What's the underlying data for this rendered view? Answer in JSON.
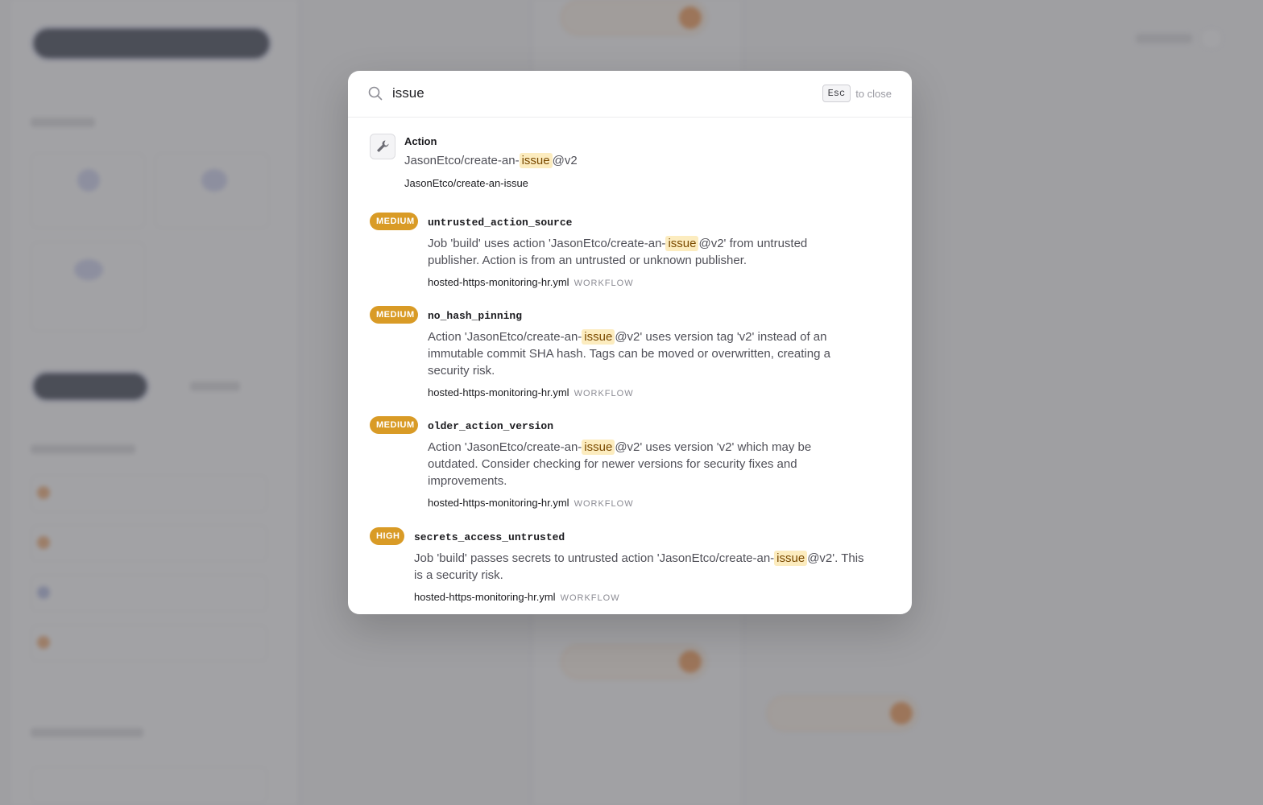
{
  "search": {
    "query": "issue",
    "esc_key": "Esc",
    "esc_hint": "to close"
  },
  "results": [
    {
      "kind": "action",
      "title": "Action",
      "desc_before": "JasonEtco/create-an-",
      "highlight": "issue",
      "desc_after": "@v2",
      "meta": "JasonEtco/create-an-issue",
      "icon": "wrench-icon"
    },
    {
      "kind": "finding",
      "severity": "MEDIUM",
      "title": "untrusted_action_source",
      "desc_before": "Job 'build' uses action 'JasonEtco/create-an-",
      "highlight": "issue",
      "desc_after": "@v2' from untrusted publisher. Action is from an untrusted or unknown publisher.",
      "file": "hosted-https-monitoring-hr.yml",
      "tag": "WORKFLOW"
    },
    {
      "kind": "finding",
      "severity": "MEDIUM",
      "title": "no_hash_pinning",
      "desc_before": "Action 'JasonEtco/create-an-",
      "highlight": "issue",
      "desc_after": "@v2' uses version tag 'v2' instead of an immutable commit SHA hash. Tags can be moved or overwritten, creating a security risk.",
      "file": "hosted-https-monitoring-hr.yml",
      "tag": "WORKFLOW"
    },
    {
      "kind": "finding",
      "severity": "MEDIUM",
      "title": "older_action_version",
      "desc_before": "Action 'JasonEtco/create-an-",
      "highlight": "issue",
      "desc_after": "@v2' uses version 'v2' which may be outdated. Consider checking for newer versions for security fixes and improvements.",
      "file": "hosted-https-monitoring-hr.yml",
      "tag": "WORKFLOW"
    },
    {
      "kind": "finding",
      "severity": "HIGH",
      "title": "secrets_access_untrusted",
      "desc_before": "Job 'build' passes secrets to untrusted action 'JasonEtco/create-an-",
      "highlight": "issue",
      "desc_after": "@v2'. This is a security risk.",
      "file": "hosted-https-monitoring-hr.yml",
      "tag": "WORKFLOW"
    }
  ],
  "colors": {
    "severity_badge": "#d99b26",
    "highlight_bg": "#fcecbf",
    "overlay": "#69696e"
  }
}
